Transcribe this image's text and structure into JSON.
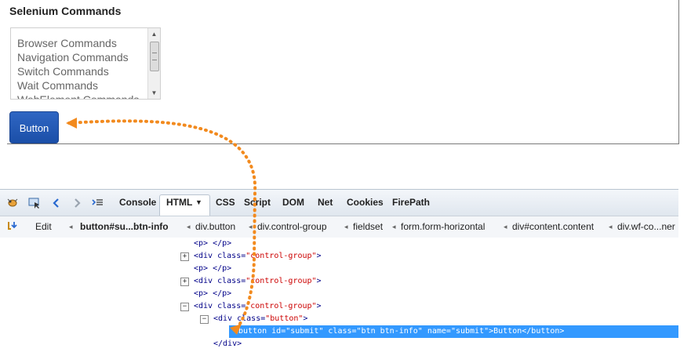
{
  "page": {
    "title": "Selenium Commands",
    "listbox_items": [
      "Browser Commands",
      "Navigation Commands",
      "Switch Commands",
      "Wait Commands",
      "WebElement Commands"
    ],
    "button_label": "Button"
  },
  "firebug": {
    "tabs": [
      "Console",
      "HTML",
      "CSS",
      "Script",
      "DOM",
      "Net",
      "Cookies",
      "FirePath"
    ],
    "active_tab": "HTML",
    "edit_label": "Edit",
    "breadcrumbs": [
      "button#su...btn-info",
      "div.button",
      "div.control-group",
      "fieldset",
      "form.form-horizontal",
      "div#content.content",
      "div.wf-co...ner"
    ],
    "code_lines": [
      {
        "tag_open": "<p>",
        "tag_close": "</p>"
      },
      {
        "pre": "<div ",
        "attr": "class=",
        "val": "\"control-group\"",
        "post": ">"
      },
      {
        "tag_open": "<p>",
        "tag_close": "</p>"
      },
      {
        "pre": "<div ",
        "attr": "class=",
        "val": "\"control-group\"",
        "post": ">"
      },
      {
        "tag_open": "<p>",
        "tag_close": "</p>"
      },
      {
        "pre": "<div ",
        "attr": "class=",
        "val": "\"control-group\"",
        "post": ">"
      },
      {
        "pre": "<div ",
        "attr": "class=",
        "val": "\"button\"",
        "post": ">"
      },
      {
        "selected": "<button id=\"submit\" class=\"btn btn-info\" name=\"submit\">Button</button>"
      },
      {
        "tag_open": "</div>"
      }
    ],
    "expander_expanded": "−",
    "expander_collapsed": "+"
  },
  "colors": {
    "annotation_arrow": "#f28a1e",
    "selection": "#3399ff",
    "button": "#1b4fa8"
  }
}
